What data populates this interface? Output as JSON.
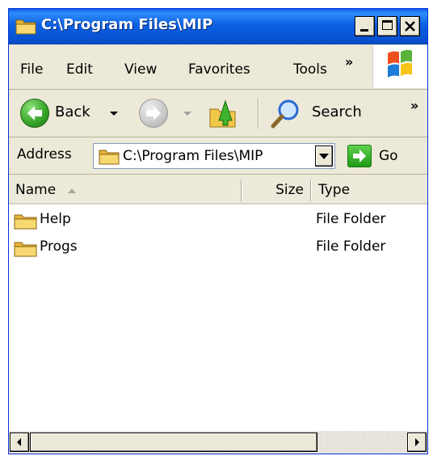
{
  "window": {
    "title": "C:\\Program Files\\MIP"
  },
  "title_buttons": {
    "minimize": "_",
    "maximize": "□",
    "close": "X"
  },
  "menu": {
    "items": [
      {
        "label": "File"
      },
      {
        "label": "Edit"
      },
      {
        "label": "View"
      },
      {
        "label": "Favorites"
      },
      {
        "label": "Tools"
      }
    ],
    "overflow": "»"
  },
  "toolbar": {
    "back_label": "Back",
    "search_label": "Search",
    "overflow": "»"
  },
  "address": {
    "label": "Address",
    "value": "C:\\Program Files\\MIP",
    "go_label": "Go"
  },
  "columns": {
    "name": "Name",
    "size": "Size",
    "type": "Type"
  },
  "files": [
    {
      "name": "Help",
      "type": "File Folder"
    },
    {
      "name": "Progs",
      "type": "File Folder"
    }
  ],
  "colors": {
    "titlebar": "#0b61e2",
    "window_bg": "#ece9d8",
    "folder_yellow": "#f5d36a"
  },
  "icons": {
    "title": "folder-icon",
    "windows_logo": "windows-flag-icon",
    "back": "back-arrow-icon",
    "forward": "forward-arrow-icon",
    "up": "up-folder-icon",
    "search": "magnifier-icon",
    "go": "go-arrow-icon"
  }
}
